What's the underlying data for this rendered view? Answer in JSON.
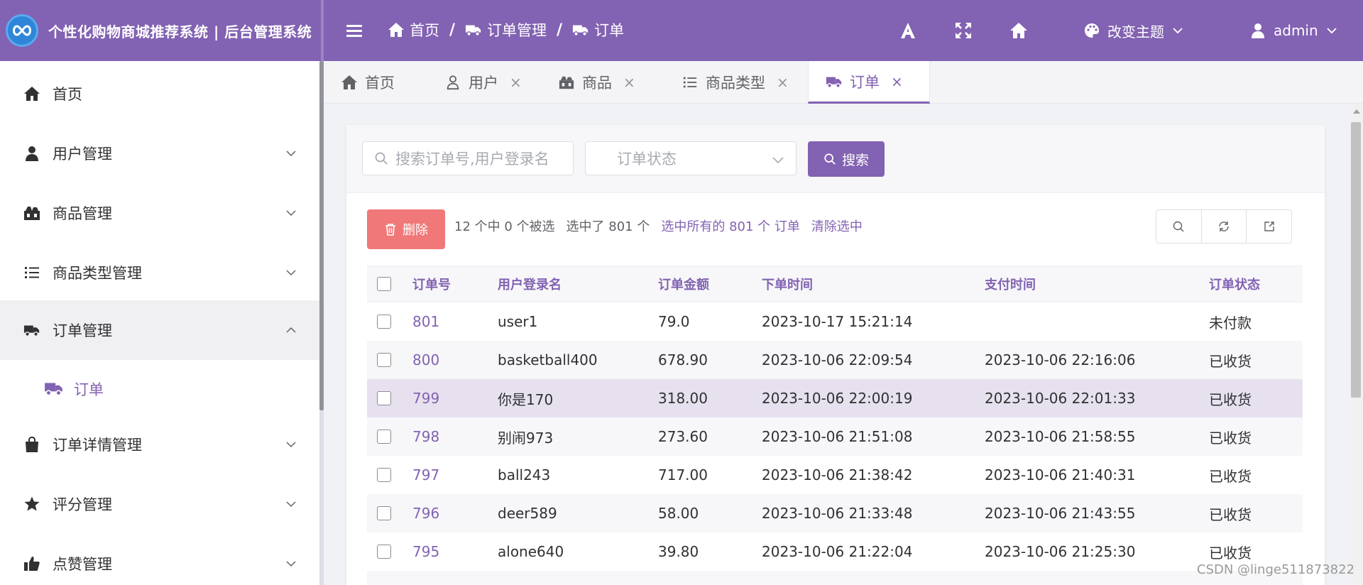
{
  "app": {
    "title": "个性化购物商城推荐系统 | 后台管理系统"
  },
  "colors": {
    "brand": "#8262b2",
    "danger": "#f07878",
    "highlight_row": "#e7e1ef"
  },
  "header": {
    "breadcrumb": [
      {
        "label": "首页",
        "icon": "home-icon"
      },
      {
        "label": "订单管理",
        "icon": "truck-icon"
      },
      {
        "label": "订单",
        "icon": "truck-icon"
      }
    ],
    "breadcrumb_sep": "/",
    "theme_label": "改变主题",
    "user": "admin"
  },
  "sidebar": {
    "items": [
      {
        "label": "首页",
        "icon": "home-icon"
      },
      {
        "label": "用户管理",
        "icon": "user-icon"
      },
      {
        "label": "商品管理",
        "icon": "goods-icon"
      },
      {
        "label": "商品类型管理",
        "icon": "list-icon"
      },
      {
        "label": "订单管理",
        "icon": "truck-icon"
      },
      {
        "label": "订单详情管理",
        "icon": "bag-icon"
      },
      {
        "label": "评分管理",
        "icon": "star-icon"
      },
      {
        "label": "点赞管理",
        "icon": "thumbs-up-icon"
      }
    ],
    "submenu": {
      "label": "订单",
      "icon": "truck-icon"
    }
  },
  "tabs": [
    {
      "label": "首页",
      "close": ""
    },
    {
      "label": "用户",
      "close": "×"
    },
    {
      "label": "商品",
      "close": "×"
    },
    {
      "label": "商品类型",
      "close": "×"
    },
    {
      "label": "订单",
      "close": "×"
    }
  ],
  "search": {
    "placeholder": "搜索订单号,用户登录名",
    "status_placeholder": "订单状态",
    "button": "搜索"
  },
  "toolbar": {
    "delete": "删除",
    "selection_count": "12 个中 0 个被选",
    "selected_total": "选中了 801 个",
    "select_all": "选中所有的 801 个 订单",
    "clear": "清除选中"
  },
  "table": {
    "headers": [
      "订单号",
      "用户登录名",
      "订单金额",
      "下单时间",
      "支付时间",
      "订单状态"
    ],
    "rows": [
      [
        "801",
        "user1",
        "79.0",
        "2023-10-17 15:21:14",
        "",
        "未付款"
      ],
      [
        "800",
        "basketball400",
        "678.90",
        "2023-10-06 22:09:54",
        "2023-10-06 22:16:06",
        "已收货"
      ],
      [
        "799",
        "你是170",
        "318.00",
        "2023-10-06 22:00:19",
        "2023-10-06 22:01:33",
        "已收货"
      ],
      [
        "798",
        "别闹973",
        "273.60",
        "2023-10-06 21:51:08",
        "2023-10-06 21:58:55",
        "已收货"
      ],
      [
        "797",
        "ball243",
        "717.00",
        "2023-10-06 21:38:42",
        "2023-10-06 21:40:31",
        "已收货"
      ],
      [
        "796",
        "deer589",
        "58.00",
        "2023-10-06 21:33:48",
        "2023-10-06 21:43:55",
        "已收货"
      ],
      [
        "795",
        "alone640",
        "39.80",
        "2023-10-06 21:22:04",
        "2023-10-06 21:25:30",
        "已收货"
      ]
    ]
  },
  "watermark": "CSDN @linge511873822"
}
